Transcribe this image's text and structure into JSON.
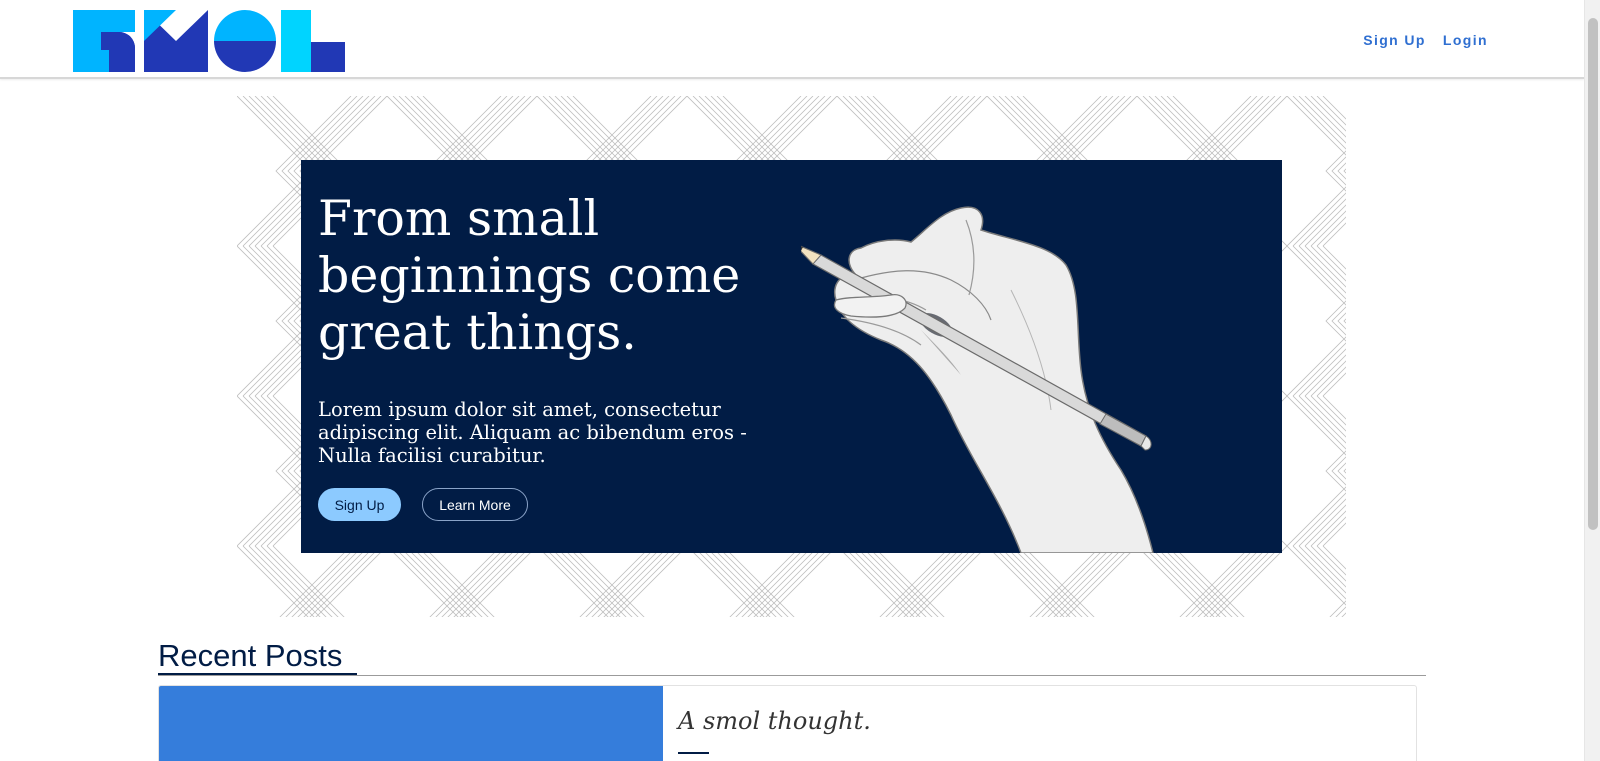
{
  "header": {
    "logo_text": "SMOL",
    "nav": {
      "signup": "Sign Up",
      "login": "Login"
    }
  },
  "hero": {
    "title": "From small beginnings come great things.",
    "text": "Lorem ipsum dolor sit amet, consectetur adipiscing elit. Aliquam ac bibendum eros - Nulla facilisi curabitur.",
    "signup_label": "Sign Up",
    "learn_label": "Learn More",
    "image": "hand-drawing-with-pencil-illustration"
  },
  "recent": {
    "title": "Recent Posts",
    "posts": [
      {
        "title": "A smol thought."
      }
    ]
  },
  "colors": {
    "navy": "#011c45",
    "accent_blue": "#2f6fd1",
    "light_blue": "#8ccaff",
    "cyan": "#00b4ff",
    "royal": "#2138b5",
    "post_image": "#357ddb"
  }
}
